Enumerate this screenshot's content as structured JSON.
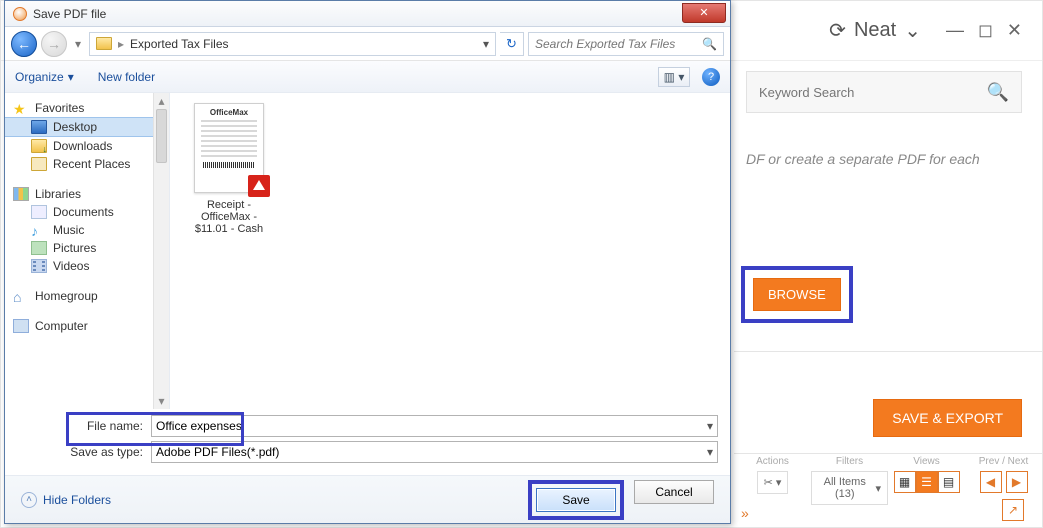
{
  "neat": {
    "brand": "Neat",
    "search_placeholder": "Keyword Search",
    "body_text": "DF or create a separate PDF for each",
    "browse": "BROWSE",
    "save_export": "SAVE & EXPORT",
    "strip": {
      "actions": "Actions",
      "filters": "Filters",
      "views": "Views",
      "prevnext": "Prev / Next",
      "filter_value": "All Items (13)"
    }
  },
  "dialog": {
    "title": "Save PDF file",
    "breadcrumb": "Exported Tax Files",
    "search_placeholder": "Search Exported Tax Files",
    "toolbar": {
      "organize": "Organize",
      "newfolder": "New folder"
    },
    "tree": {
      "favorites": "Favorites",
      "desktop": "Desktop",
      "downloads": "Downloads",
      "recent": "Recent Places",
      "libraries": "Libraries",
      "documents": "Documents",
      "music": "Music",
      "pictures": "Pictures",
      "videos": "Videos",
      "homegroup": "Homegroup",
      "computer": "Computer"
    },
    "file": {
      "thumb_brand": "OfficeMax",
      "label_l1": "Receipt -",
      "label_l2": "OfficeMax -",
      "label_l3": "$11.01 - Cash"
    },
    "fields": {
      "filename_label": "File name:",
      "filename_value": "Office expenses",
      "savetype_label": "Save as type:",
      "savetype_value": "Adobe PDF Files(*.pdf)"
    },
    "footer": {
      "hide_folders": "Hide Folders",
      "save": "Save",
      "cancel": "Cancel"
    }
  }
}
